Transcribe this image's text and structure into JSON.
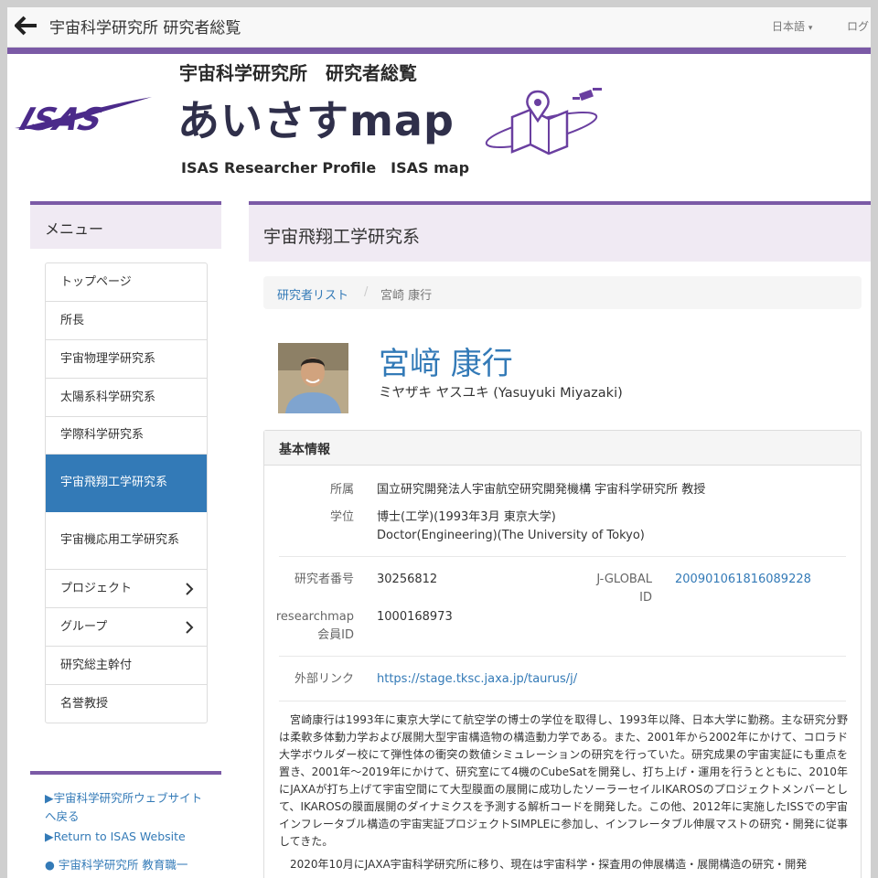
{
  "topbar": {
    "site_title": "宇宙科学研究所 研究者総覧",
    "language": "日本語",
    "login": "ログ"
  },
  "header": {
    "logo_text": "ISAS",
    "subtitle": "宇宙科学研究所　研究者総覧",
    "main_title": "あいさすmap",
    "english_title": "ISAS Researcher Profile　ISAS map"
  },
  "sidebar": {
    "heading": "メニュー",
    "items": [
      {
        "label": "トップページ"
      },
      {
        "label": "所長"
      },
      {
        "label": "宇宙物理学研究系"
      },
      {
        "label": "太陽系科学研究系"
      },
      {
        "label": "学際科学研究系"
      },
      {
        "label": "宇宙飛翔工学研究系",
        "active": true
      },
      {
        "label": "宇宙機応用工学研究系"
      },
      {
        "label": "プロジェクト",
        "chevron": true
      },
      {
        "label": "グループ",
        "chevron": true
      },
      {
        "label": "研究総主幹付"
      },
      {
        "label": "名誉教授"
      }
    ],
    "links": [
      "▶宇宙科学研究所ウェブサイトへ戻る",
      "▶Return to ISAS Website",
      "● 宇宙科学研究所 教育職一"
    ]
  },
  "main": {
    "department": "宇宙飛翔工学研究系",
    "breadcrumb": {
      "list": "研究者リスト",
      "separator": "/",
      "current": "宮崎 康行"
    },
    "researcher": {
      "name_ja": "宮﨑 康行",
      "name_kana": "ミヤザキ ヤスユキ  (Yasuyuki Miyazaki)"
    },
    "info": {
      "heading": "基本情報",
      "affiliation_label": "所属",
      "affiliation": "国立研究開発法人宇宙航空研究開発機構 宇宙科学研究所 教授",
      "degree_label": "学位",
      "degree_ja": "博士(工学)(1993年3月 東京大学)",
      "degree_en": "Doctor(Engineering)(The University of Tokyo)",
      "researcher_no_label": "研究者番号",
      "researcher_no": "30256812",
      "jglobal_label_1": "J-GLOBAL",
      "jglobal_label_2": "ID",
      "jglobal_id": "200901061816089228",
      "researchmap_label_1": "researchmap",
      "researchmap_label_2": "会員ID",
      "researchmap_id": "1000168973",
      "external_label": "外部リンク",
      "external_url": "https://stage.tksc.jaxa.jp/taurus/j/"
    },
    "bio_1": "宮崎康行は1993年に東京大学にて航空学の博士の学位を取得し、1993年以降、日本大学に勤務。主な研究分野は柔軟多体動力学および展開大型宇宙構造物の構造動力学である。また、2001年から2002年にかけて、コロラド大学ボウルダー校にて弾性体の衝突の数値シミュレーションの研究を行っていた。研究成果の宇宙実証にも重点を置き、2001年～2019年にかけて、研究室にて4機のCubeSatを開発し、打ち上げ・運用を行うとともに、2010年にJAXAが打ち上げて宇宙空間にて大型膜面の展開に成功したソーラーセイルIKAROSのプロジェクトメンバーとして、IKAROSの膜面展開のダイナミクスを予測する解析コードを開発した。この他、2012年に実施したISSでの宇宙インフレータブル構造の宇宙実証プロジェクトSIMPLEに参加し、インフレータブル伸展マストの研究・開発に従事してきた。",
    "bio_2": "2020年10月にJAXA宇宙科学研究所に移り、現在は宇宙科学・探査用の伸展構造・展開構造の研究・開発"
  },
  "colors": {
    "accent_purple": "#7b5aa6",
    "link_blue": "#337ab7",
    "active_blue": "#337ab7"
  }
}
